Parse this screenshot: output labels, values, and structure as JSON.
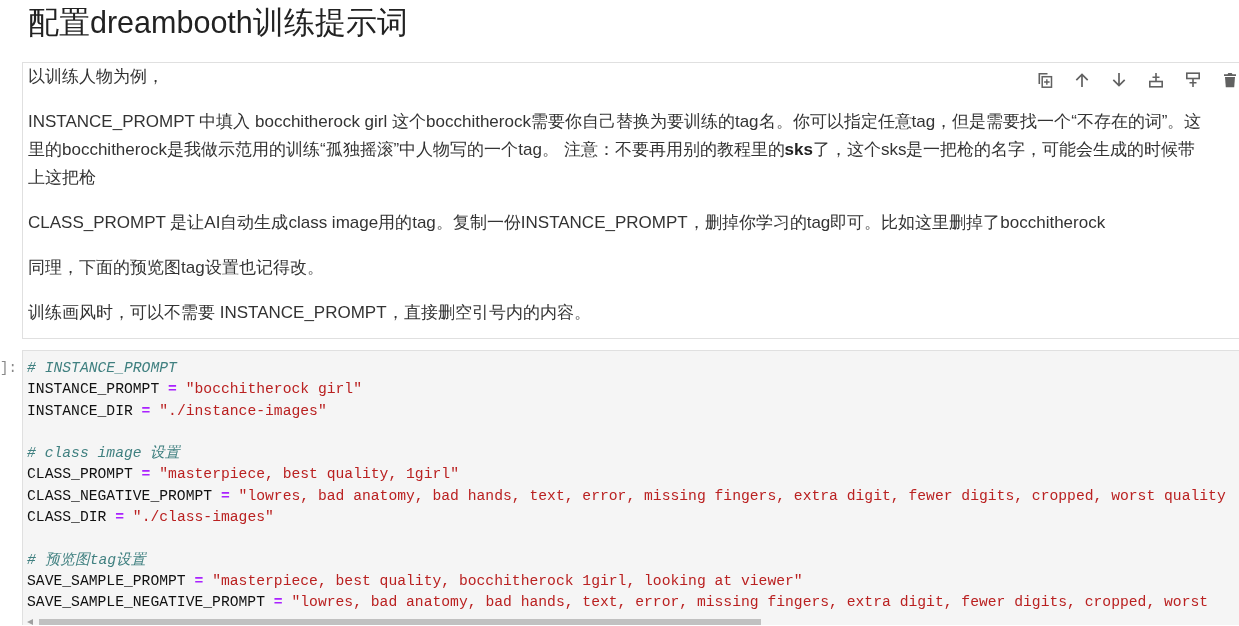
{
  "title": "配置dreambooth训练提示词",
  "markdown_cell": {
    "paragraphs": [
      "以训练人物为例，",
      "INSTANCE_PROMPT 中填入 bocchitherock girl 这个bocchitherock需要你自己替换为要训练的tag名。你可以指定任意tag，但是需要找一个“不存在的词”。这里的bocchitherock是我做示范用的训练“孤独摇滚”中人物写的一个tag。 注意：不要再用别的教程里的**sks**了，这个sks是一把枪的名字，可能会生成的时候带上这把枪",
      "CLASS_PROMPT 是让AI自动生成class image用的tag。复制一份INSTANCE_PROMPT，删掉你学习的tag即可。比如这里删掉了bocchitherock",
      "同理，下面的预览图tag设置也记得改。",
      "训练画风时，可以不需要 INSTANCE_PROMPT，直接删空引号内的内容。"
    ]
  },
  "code_cell": {
    "prompt": "]:",
    "lines": [
      {
        "kind": "comment",
        "text": "# INSTANCE_PROMPT"
      },
      {
        "kind": "assign",
        "name": "INSTANCE_PROMPT",
        "operator": "=",
        "value": "\"bocchitherock girl\""
      },
      {
        "kind": "assign",
        "name": "INSTANCE_DIR",
        "operator": "=",
        "value": "\"./instance-images\""
      },
      {
        "kind": "blank"
      },
      {
        "kind": "comment",
        "text": "# class image 设置"
      },
      {
        "kind": "assign",
        "name": "CLASS_PROMPT",
        "operator": "=",
        "value": "\"masterpiece, best quality, 1girl\""
      },
      {
        "kind": "assign",
        "name": "CLASS_NEGATIVE_PROMPT",
        "operator": "=",
        "value": "\"lowres, bad anatomy, bad hands, text, error, missing fingers, extra digit, fewer digits, cropped, worst quality"
      },
      {
        "kind": "assign",
        "name": "CLASS_DIR",
        "operator": "=",
        "value": "\"./class-images\""
      },
      {
        "kind": "blank"
      },
      {
        "kind": "comment",
        "text": "# 预览图tag设置"
      },
      {
        "kind": "assign",
        "name": "SAVE_SAMPLE_PROMPT",
        "operator": "=",
        "value": "\"masterpiece, best quality, bocchitherock 1girl, looking at viewer\""
      },
      {
        "kind": "assign",
        "name": "SAVE_SAMPLE_NEGATIVE_PROMPT",
        "operator": "=",
        "value": "\"lowres, bad anatomy, bad hands, text, error, missing fingers, extra digit, fewer digits, cropped, worst"
      }
    ]
  }
}
